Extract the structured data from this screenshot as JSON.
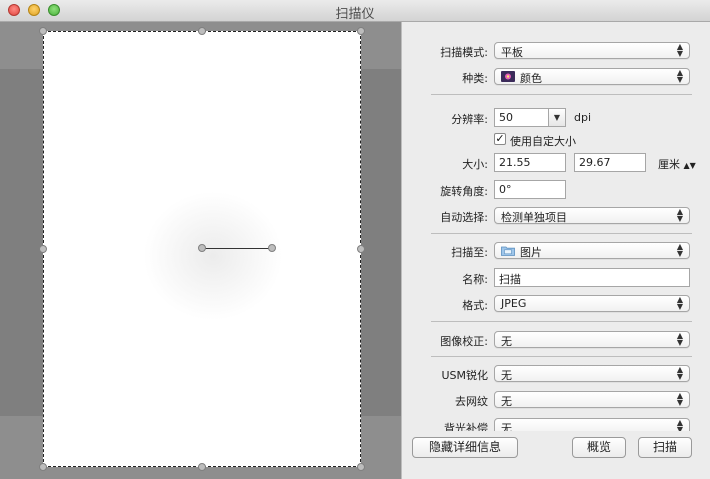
{
  "window": {
    "title": "扫描仪"
  },
  "settings": {
    "scan_mode": {
      "label": "扫描模式:",
      "value": "平板"
    },
    "kind": {
      "label": "种类:",
      "value": "颜色",
      "icon": "color-flower-icon"
    },
    "resolution": {
      "label": "分辨率:",
      "value": "50",
      "unit": "dpi"
    },
    "custom_size": {
      "label": "使用自定大小",
      "checked": true,
      "check_glyph": "✓"
    },
    "size": {
      "label": "大小:",
      "width": "21.55",
      "height": "29.67",
      "unit": "厘米"
    },
    "rotation": {
      "label": "旋转角度:",
      "value": "0°"
    },
    "auto_select": {
      "label": "自动选择:",
      "value": "检测单独项目"
    },
    "scan_to": {
      "label": "扫描至:",
      "value": "图片",
      "icon": "folder-icon"
    },
    "name": {
      "label": "名称:",
      "value": "扫描"
    },
    "format": {
      "label": "格式:",
      "value": "JPEG"
    },
    "image_correction": {
      "label": "图像校正:",
      "value": "无"
    },
    "unsharp_mask": {
      "label": "USM锐化",
      "value": "无"
    },
    "descreen": {
      "label": "去网纹",
      "value": "无"
    },
    "backlight": {
      "label": "背光补偿",
      "value": "无"
    }
  },
  "buttons": {
    "hide_details": "隐藏详细信息",
    "overview": "概览",
    "scan": "扫描"
  }
}
